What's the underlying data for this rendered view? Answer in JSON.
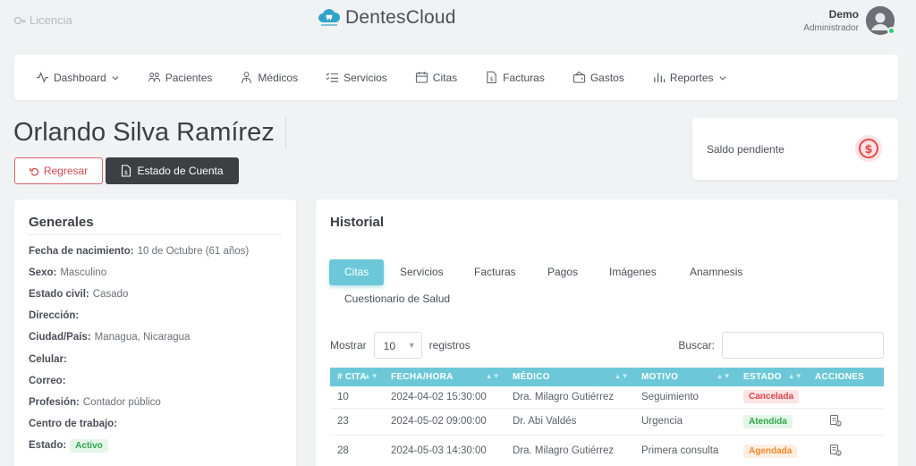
{
  "topbar": {
    "license": "Licencia",
    "logo_text": "DentesCloud",
    "user_name": "Demo",
    "user_role": "Administrador"
  },
  "nav": [
    {
      "label": "Dashboard",
      "icon": "activity-icon",
      "caret": true
    },
    {
      "label": "Pacientes",
      "icon": "users-icon"
    },
    {
      "label": "Médicos",
      "icon": "doctor-icon"
    },
    {
      "label": "Servicios",
      "icon": "list-icon"
    },
    {
      "label": "Citas",
      "icon": "calendar-icon"
    },
    {
      "label": "Facturas",
      "icon": "invoice-icon"
    },
    {
      "label": "Gastos",
      "icon": "wallet-icon"
    },
    {
      "label": "Reportes",
      "icon": "bar-chart-icon",
      "caret": true
    }
  ],
  "patient": {
    "name": "Orlando Silva Ramírez"
  },
  "actions": {
    "back": "Regresar",
    "statement": "Estado de Cuenta"
  },
  "saldo": {
    "label": "Saldo pendiente"
  },
  "generales": {
    "title": "Generales",
    "fields": [
      {
        "label": "Fecha de nacimiento:",
        "value": "10 de Octubre (61 años)"
      },
      {
        "label": "Sexo:",
        "value": "Masculino"
      },
      {
        "label": "Estado civil:",
        "value": "Casado"
      },
      {
        "label": "Dirección:",
        "value": ""
      },
      {
        "label": "Ciudad/País:",
        "value": "Managua, Nicaragua"
      },
      {
        "label": "Celular:",
        "value": ""
      },
      {
        "label": "Correo:",
        "value": ""
      },
      {
        "label": "Profesión:",
        "value": "Contador público"
      },
      {
        "label": "Centro de trabajo:",
        "value": ""
      }
    ],
    "estado_label": "Estado:",
    "estado_value": "Activo"
  },
  "historial": {
    "title": "Historial",
    "tabs": [
      "Citas",
      "Servicios",
      "Facturas",
      "Pagos",
      "Imágenes",
      "Anamnesis",
      "Cuestionario de Salud"
    ],
    "active_tab": "Citas",
    "show_label": "Mostrar",
    "show_value": "10",
    "records_label": "registros",
    "search_label": "Buscar:",
    "columns": [
      "# CITA",
      "FECHA/HORA",
      "MÉDICO",
      "MOTIVO",
      "ESTADO",
      "ACCIONES"
    ],
    "rows": [
      {
        "id": "10",
        "date": "2024-04-02 15:30:00",
        "doctor": "Dra. Milagro Gutiérrez",
        "reason": "Seguimiento",
        "status": "Cancelada",
        "status_color": "#d9474c"
      },
      {
        "id": "23",
        "date": "2024-05-02 09:00:00",
        "doctor": "Dr. Abi Valdés",
        "reason": "Urgencia",
        "status": "Atendida",
        "status_color": "#31a24c"
      },
      {
        "id": "28",
        "date": "2024-05-03 14:30:00",
        "doctor": "Dra. Milagro Gutiérrez",
        "reason": "Primera consulta",
        "status": "Agendada",
        "status_color": "#f08a2e"
      }
    ]
  },
  "colors": {
    "accent": "#6cc8d8",
    "danger": "#d9474c",
    "dark_button": "#3d3f42",
    "background": "#f1f2f4"
  }
}
